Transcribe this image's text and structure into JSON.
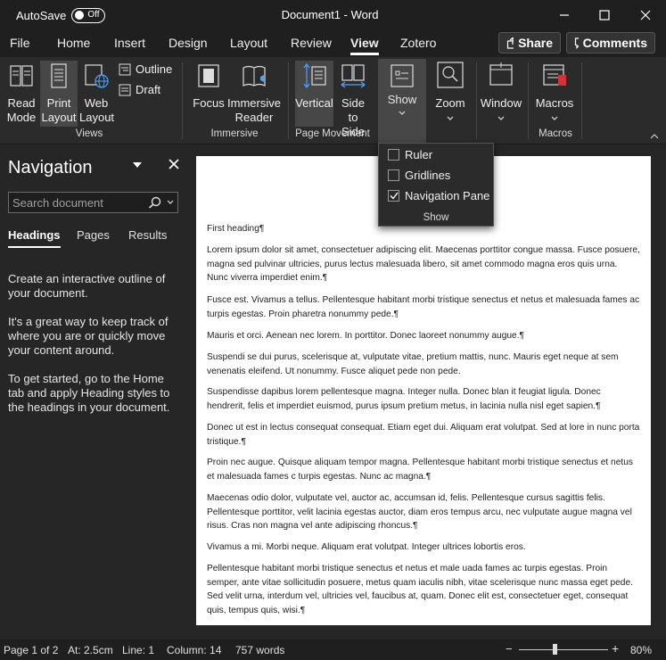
{
  "titlebar": {
    "autosave_label": "AutoSave",
    "autosave_state": "Off",
    "document_title": "Document1 - Word"
  },
  "tabs": [
    "File",
    "Home",
    "Insert",
    "Design",
    "Layout",
    "Review",
    "View",
    "Zotero"
  ],
  "active_tab": "View",
  "share_label": "Share",
  "comments_label": "Comments",
  "ribbon": {
    "read_mode": [
      "Read",
      "Mode"
    ],
    "print_layout": [
      "Print",
      "Layout"
    ],
    "web_layout": [
      "Web",
      "Layout"
    ],
    "outline": "Outline",
    "draft": "Draft",
    "views_group": "Views",
    "focus": "Focus",
    "immersive_reader": [
      "Immersive",
      "Reader"
    ],
    "immersive_group": "Immersive",
    "vertical": "Vertical",
    "side_to_side": [
      "Side",
      "to Side"
    ],
    "page_movement_group": "Page Movement",
    "show": "Show",
    "zoom": "Zoom",
    "window": "Window",
    "macros": "Macros",
    "macros_group": "Macros"
  },
  "show_menu": {
    "items": [
      {
        "label": "Ruler",
        "checked": false
      },
      {
        "label": "Gridlines",
        "checked": false
      },
      {
        "label": "Navigation Pane",
        "checked": true
      }
    ],
    "group_label": "Show"
  },
  "navigation": {
    "title": "Navigation",
    "search_placeholder": "Search document",
    "tabs": [
      "Headings",
      "Pages",
      "Results"
    ],
    "active_tab": "Headings",
    "help": [
      "Create an interactive outline of your document.",
      "It's a great way to keep track of where you are or quickly move your content around.",
      "To get started, go to the Home tab and apply Heading styles to the headings in your document."
    ]
  },
  "document": {
    "paragraphs": [
      "First heading¶",
      "Lorem ipsum dolor sit amet, consectetuer adipiscing elit. Maecenas porttitor congue massa. Fusce posuere, magna sed pulvinar ultricies, purus lectus malesuada libero, sit amet commodo magna eros quis urna. Nunc viverra imperdiet enim.¶",
      "Fusce est. Vivamus a tellus. Pellentesque habitant morbi tristique senectus et netus et malesuada fames ac turpis egestas. Proin pharetra nonummy pede.¶",
      "Mauris et orci. Aenean nec lorem. In porttitor. Donec laoreet nonummy augue.¶",
      "Suspendi se dui purus, scelerisque at, vulputate vitae, pretium mattis, nunc. Mauris eget neque at sem venenatis eleifend. Ut nonummy. Fusce aliquet pede non pede.",
      "Suspendisse dapibus lorem pellentesque magna. Integer nulla. Donec blan it feugiat ligula. Donec hendrerit, felis et imperdiet euismod, purus ipsum pretium metus, in lacinia nulla nisl eget sapien.¶",
      "Donec ut est in lectus consequat consequat. Etiam eget dui. Aliquam erat volutpat. Sed at lore in nunc porta tristique.¶",
      "Proin nec augue. Quisque aliquam tempor magna. Pellentesque habitant morbi tristique senectus et netus et malesuada fames c turpis egestas. Nunc ac magna.¶",
      "Maecenas odio dolor, vulputate vel, auctor ac, accumsan id, felis. Pellentesque cursus sagittis felis. Pellentesque porttitor, velit lacinia egestas auctor, diam eros tempus arcu, nec vulputate augue magna vel risus. Cras non magna vel ante adipiscing rhoncus.¶",
      "Vivamus a mi. Morbi neque. Aliquam erat volutpat. Integer ultrices lobortis eros.",
      "Pellentesque habitant morbi tristique senectus et netus et male uada fames ac turpis egestas. Proin semper, ante vitae sollicitudin posuere, metus quam iaculis nibh, vitae scelerisque nunc massa eget pede. Sed velit urna, interdum vel, ultricies vel, faucibus at, quam. Donec elit est, consectetuer eget, consequat quis, tempus quis, wisi.¶"
    ]
  },
  "status": {
    "page": "Page 1 of 2",
    "at": "At: 2.5cm",
    "line": "Line: 1",
    "column": "Column: 14",
    "words": "757 words",
    "zoom_minus": "−",
    "zoom_plus": "+",
    "zoom_level": "80%",
    "zoom_fraction": 0.4
  }
}
